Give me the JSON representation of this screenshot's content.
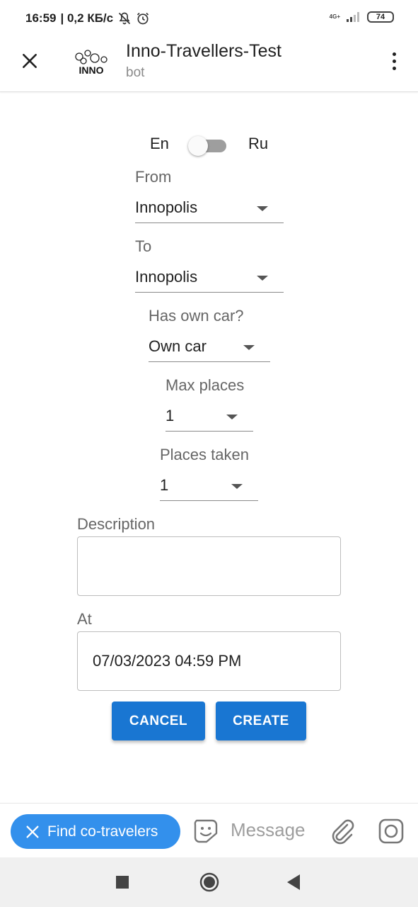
{
  "status_bar": {
    "time": "16:59",
    "speed": "| 0,2 КБ/с",
    "network": "4G+",
    "battery": "74",
    "icons": [
      "mute-icon",
      "alarm-icon",
      "signal-icon",
      "battery-icon"
    ]
  },
  "header": {
    "title": "Inno-Travellers-Test",
    "subtitle": "bot",
    "logo_text": "INNO",
    "icons": [
      "close-icon",
      "more-vert-icon"
    ]
  },
  "form": {
    "lang_left": "En",
    "lang_right": "Ru",
    "from_label": "From",
    "from_value": "Innopolis",
    "to_label": "To",
    "to_value": "Innopolis",
    "car_label": "Has own car?",
    "car_value": "Own car",
    "max_places_label": "Max places",
    "max_places_value": "1",
    "places_taken_label": "Places taken",
    "places_taken_value": "1",
    "description_label": "Description",
    "description_value": "",
    "at_label": "At",
    "at_value": "07/03/2023 04:59 PM",
    "cancel_label": "CANCEL",
    "create_label": "CREATE"
  },
  "bottom": {
    "chip_label": "Find co-travelers",
    "message_placeholder": "Message",
    "icons": [
      "close-icon",
      "sticker-icon",
      "attach-icon",
      "camera-icon"
    ]
  },
  "navigation": {
    "icons": [
      "recents-icon",
      "home-icon",
      "back-icon"
    ]
  },
  "colors": {
    "accent": "#1976d2",
    "chip": "#3390ec",
    "label": "#666666",
    "switch_track": "#9e9e9e"
  }
}
